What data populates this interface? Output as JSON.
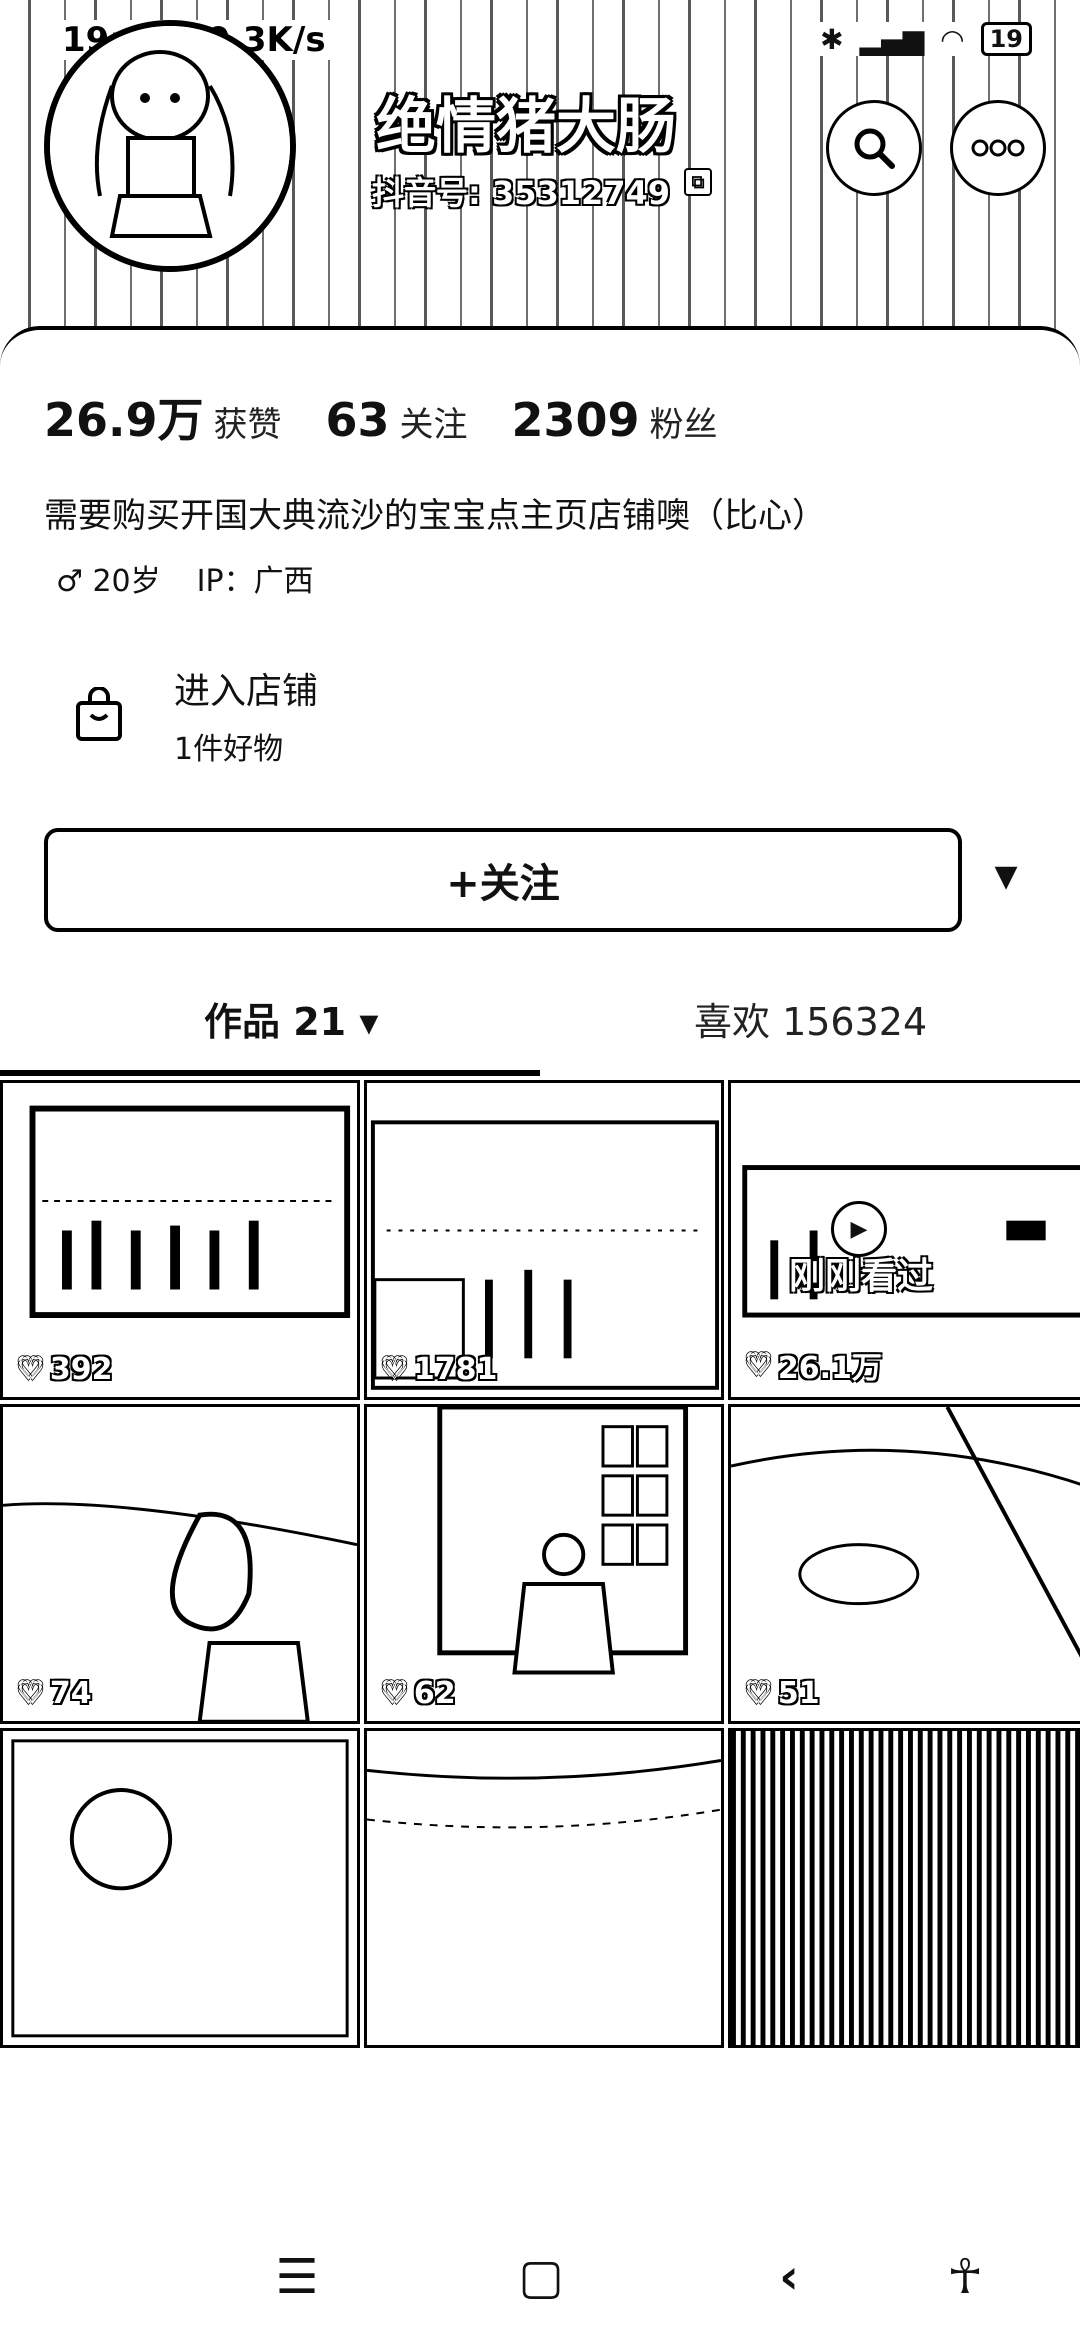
{
  "status_bar": {
    "time_speed": "19:44 | 0.3K/s",
    "battery": "19"
  },
  "profile": {
    "name": "绝情猪大肠",
    "douyin_id": "抖音号: 35312749"
  },
  "stats": [
    {
      "value": "26.9万",
      "label": "获赞"
    },
    {
      "value": "63",
      "label": "关注"
    },
    {
      "value": "2309",
      "label": "粉丝"
    }
  ],
  "bio": "需要购买开国大典流沙的宝宝点主页店铺噢（比心）",
  "meta": {
    "gender_icon": "♂",
    "age": "20岁",
    "ip": "IP：广西"
  },
  "shop": {
    "title": "进入店铺",
    "subtitle": "1件好物"
  },
  "follow": {
    "label": "+关注",
    "dropdown": "▼"
  },
  "tabs": {
    "works": "作品 21 ▾",
    "likes": "喜欢 156324"
  },
  "videos": [
    {
      "likes": "392"
    },
    {
      "likes": "1781"
    },
    {
      "likes": "26.1万",
      "badge": "刚刚看过"
    },
    {
      "likes": "74"
    },
    {
      "likes": "62"
    },
    {
      "likes": "51"
    },
    {
      "likes": ""
    },
    {
      "likes": ""
    },
    {
      "likes": ""
    }
  ],
  "icons": {
    "search": "search-icon",
    "more": "more-icon",
    "shop": "shopping-bag-icon",
    "heart": "heart-icon",
    "play": "play-icon",
    "nav_menu": "menu-icon",
    "nav_home": "home-icon",
    "nav_back": "back-icon",
    "nav_accessibility": "accessibility-icon"
  }
}
